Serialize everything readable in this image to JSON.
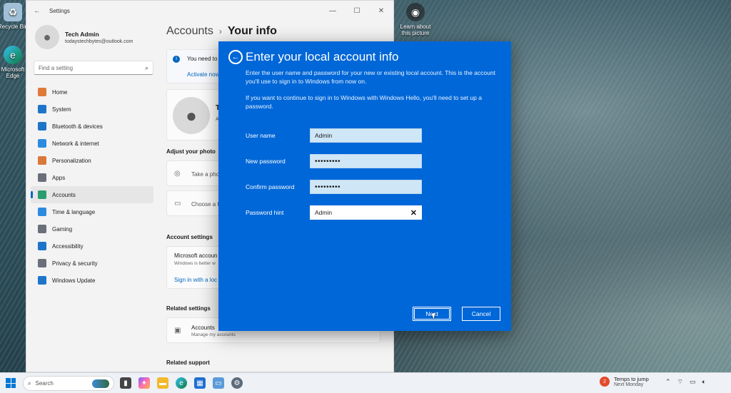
{
  "desktop": {
    "recycle_label": "Recycle Bin",
    "edge_label": "Microsoft Edge",
    "learn_label": "Learn about this picture"
  },
  "settings": {
    "window_title": "Settings",
    "user_name": "Tech Admin",
    "user_email": "todaystechbytes@outlook.com",
    "search_placeholder": "Find a setting",
    "nav": [
      {
        "label": "Home",
        "icon": "home-icon",
        "color": "#e07a39"
      },
      {
        "label": "System",
        "icon": "system-icon",
        "color": "#1e74c9"
      },
      {
        "label": "Bluetooth & devices",
        "icon": "bluetooth-icon",
        "color": "#1e74c9"
      },
      {
        "label": "Network & internet",
        "icon": "network-icon",
        "color": "#2b8be0"
      },
      {
        "label": "Personalization",
        "icon": "brush-icon",
        "color": "#d9783a"
      },
      {
        "label": "Apps",
        "icon": "apps-icon",
        "color": "#6a6f7a"
      },
      {
        "label": "Accounts",
        "icon": "accounts-icon",
        "color": "#2a9d6f"
      },
      {
        "label": "Time & language",
        "icon": "time-icon",
        "color": "#2b8be0"
      },
      {
        "label": "Gaming",
        "icon": "gaming-icon",
        "color": "#6a6f7a"
      },
      {
        "label": "Accessibility",
        "icon": "accessibility-icon",
        "color": "#1e74c9"
      },
      {
        "label": "Privacy & security",
        "icon": "shield-icon",
        "color": "#6a6f7a"
      },
      {
        "label": "Windows Update",
        "icon": "update-icon",
        "color": "#1e74c9"
      }
    ],
    "active_nav": "Accounts",
    "breadcrumb_parent": "Accounts",
    "breadcrumb_current": "Your info",
    "notice_text": "You need to",
    "notice_link": "Activate now",
    "card_name": "TE",
    "card_account": "Acco",
    "adjust_photo_heading": "Adjust your photo",
    "take_photo": "Take a pho",
    "choose_file": "Choose a f",
    "account_settings_heading": "Account settings",
    "ms_account_title": "Microsoft accoun",
    "ms_account_desc": "Windows is better w",
    "ms_account_link": "Sign in with a loc",
    "related_settings_heading": "Related settings",
    "accounts_row_title": "Accounts",
    "accounts_row_desc": "Manage my accounts",
    "related_support_heading": "Related support"
  },
  "dialog": {
    "title": "Enter your local account info",
    "desc1": "Enter the user name and password for your new or existing local account. This is the account you'll use to sign in to Windows from now on.",
    "desc2": "If you want to continue to sign in to Windows with Windows Hello, you'll need to set up a password.",
    "fields": {
      "user_name": {
        "label": "User name",
        "value": "Admin"
      },
      "new_password": {
        "label": "New password",
        "value": "•••••••••"
      },
      "confirm_password": {
        "label": "Confirm password",
        "value": "•••••••••"
      },
      "password_hint": {
        "label": "Password hint",
        "value": "Admin"
      }
    },
    "next_label": "Next",
    "cancel_label": "Cancel",
    "accent": "#0067d8"
  },
  "taskbar": {
    "search_placeholder": "Search",
    "weather_title": "Temps to jump",
    "weather_sub": "Next Monday",
    "weather_badge": "2"
  }
}
